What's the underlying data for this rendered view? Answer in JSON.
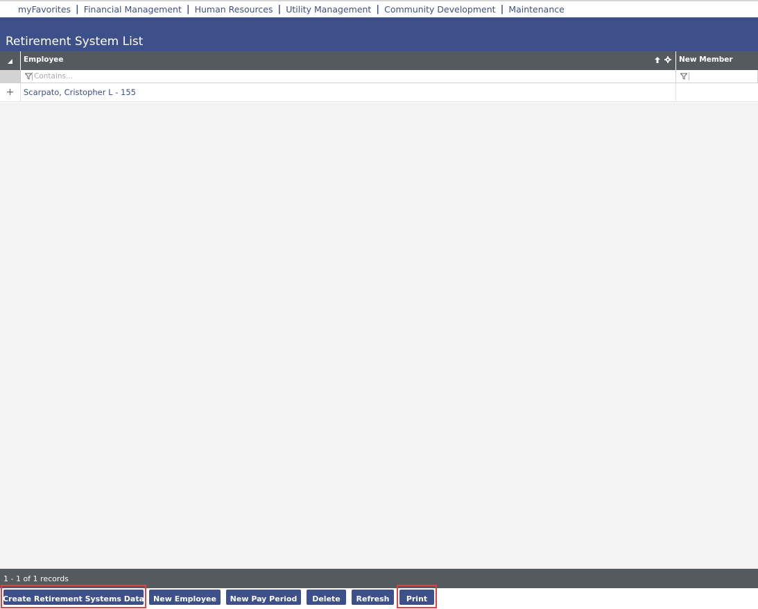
{
  "nav": {
    "items": [
      {
        "label": "myFavorites"
      },
      {
        "label": "Financial Management"
      },
      {
        "label": "Human Resources"
      },
      {
        "label": "Utility Management"
      },
      {
        "label": "Community Development"
      },
      {
        "label": "Maintenance"
      }
    ],
    "separator": "|"
  },
  "page": {
    "title": "Retirement System List"
  },
  "grid": {
    "columns": {
      "employee": "Employee",
      "new_member": "New Member"
    },
    "filter": {
      "employee_placeholder": "Contains..."
    },
    "rows": [
      {
        "expand": "+",
        "employee": "Scarpato, Cristopher L - 155",
        "new_member": ""
      }
    ]
  },
  "footer": {
    "records": "1 - 1 of 1 records"
  },
  "buttons": {
    "create": "Create Retirement Systems Data",
    "new_employee": "New Employee",
    "new_pay_period": "New Pay Period",
    "delete": "Delete",
    "refresh": "Refresh",
    "print": "Print"
  },
  "colors": {
    "primary": "#3e5089",
    "header_gray": "#545a5e",
    "link": "#3d4f86",
    "highlight": "#e04040"
  }
}
